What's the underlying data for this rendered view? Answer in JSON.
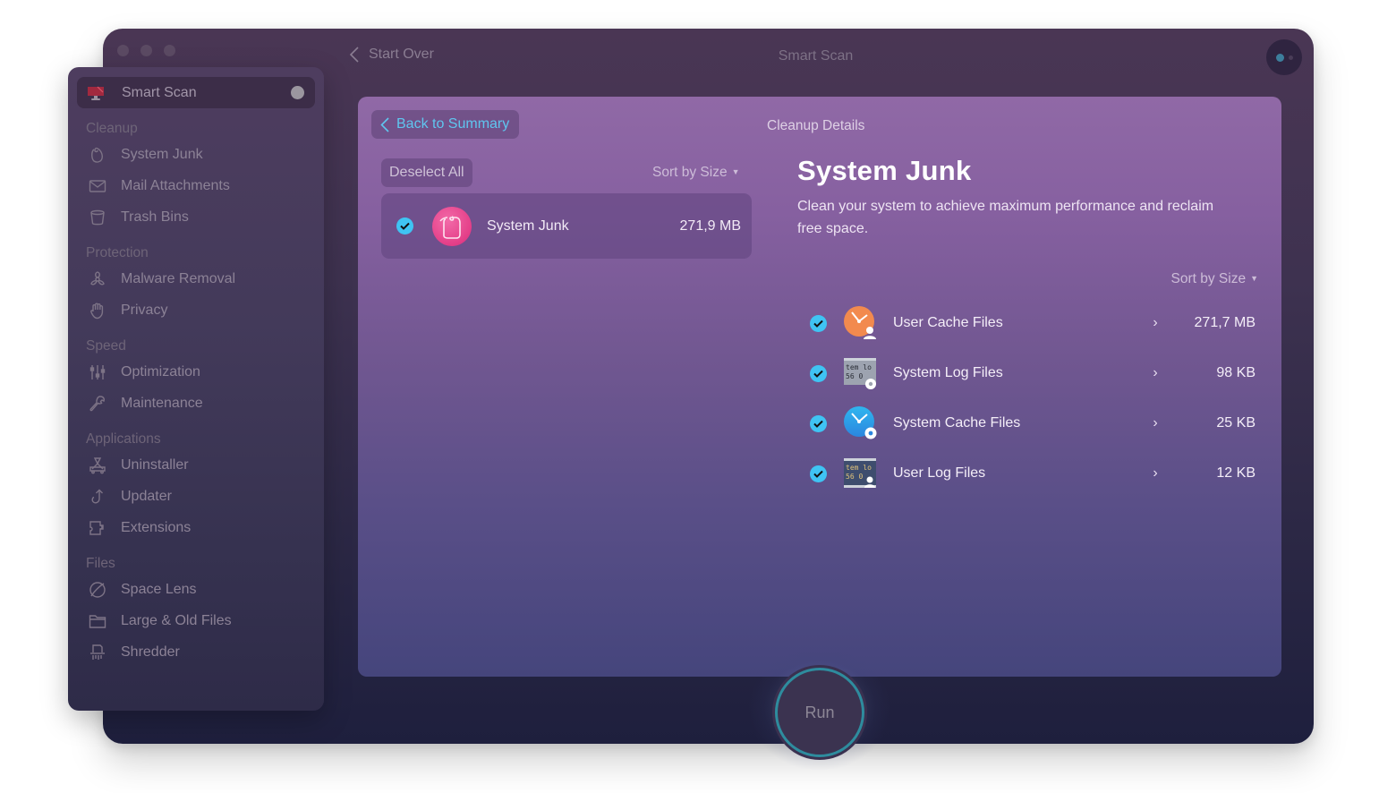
{
  "window": {
    "title": "Smart Scan",
    "start_over_label": "Start Over",
    "traffic_lights": [
      "close",
      "minimize",
      "zoom"
    ],
    "assistant_icon": "assistant-icon"
  },
  "sidebar": {
    "active_item": {
      "label": "Smart Scan",
      "icon": "smart-scan-monitor-icon"
    },
    "sections": [
      {
        "title": "Cleanup",
        "items": [
          {
            "label": "System Junk",
            "icon": "system-junk-icon"
          },
          {
            "label": "Mail Attachments",
            "icon": "mail-icon"
          },
          {
            "label": "Trash Bins",
            "icon": "trash-icon"
          }
        ]
      },
      {
        "title": "Protection",
        "items": [
          {
            "label": "Malware Removal",
            "icon": "biohazard-icon"
          },
          {
            "label": "Privacy",
            "icon": "hand-icon"
          }
        ]
      },
      {
        "title": "Speed",
        "items": [
          {
            "label": "Optimization",
            "icon": "sliders-icon"
          },
          {
            "label": "Maintenance",
            "icon": "wrench-icon"
          }
        ]
      },
      {
        "title": "Applications",
        "items": [
          {
            "label": "Uninstaller",
            "icon": "uninstaller-icon"
          },
          {
            "label": "Updater",
            "icon": "updater-icon"
          },
          {
            "label": "Extensions",
            "icon": "puzzle-icon"
          }
        ]
      },
      {
        "title": "Files",
        "items": [
          {
            "label": "Space Lens",
            "icon": "space-lens-icon"
          },
          {
            "label": "Large & Old Files",
            "icon": "folder-icon"
          },
          {
            "label": "Shredder",
            "icon": "shredder-icon"
          }
        ]
      }
    ]
  },
  "panel": {
    "back_label": "Back to Summary",
    "header": "Cleanup Details",
    "deselect_label": "Deselect All",
    "sort_label": "Sort by Size",
    "group": {
      "name": "System Junk",
      "size": "271,9 MB",
      "checked": true
    },
    "detail": {
      "title": "System Junk",
      "description": "Clean your system to achieve maximum performance and reclaim free space.",
      "sort_label": "Sort by Size",
      "items": [
        {
          "name": "User Cache Files",
          "size": "271,7 MB",
          "checked": true,
          "icon": "user-cache-icon"
        },
        {
          "name": "System Log Files",
          "size": "98 KB",
          "checked": true,
          "icon": "system-log-icon"
        },
        {
          "name": "System Cache Files",
          "size": "25 KB",
          "checked": true,
          "icon": "system-cache-icon"
        },
        {
          "name": "User Log Files",
          "size": "12 KB",
          "checked": true,
          "icon": "user-log-icon"
        }
      ]
    }
  },
  "run_button": {
    "label": "Run"
  },
  "colors": {
    "accent_blue": "#3fc4f3",
    "link_blue": "#5fc6ef",
    "run_ring": "#2e8c9e",
    "junk_pink": "#e43e88"
  }
}
